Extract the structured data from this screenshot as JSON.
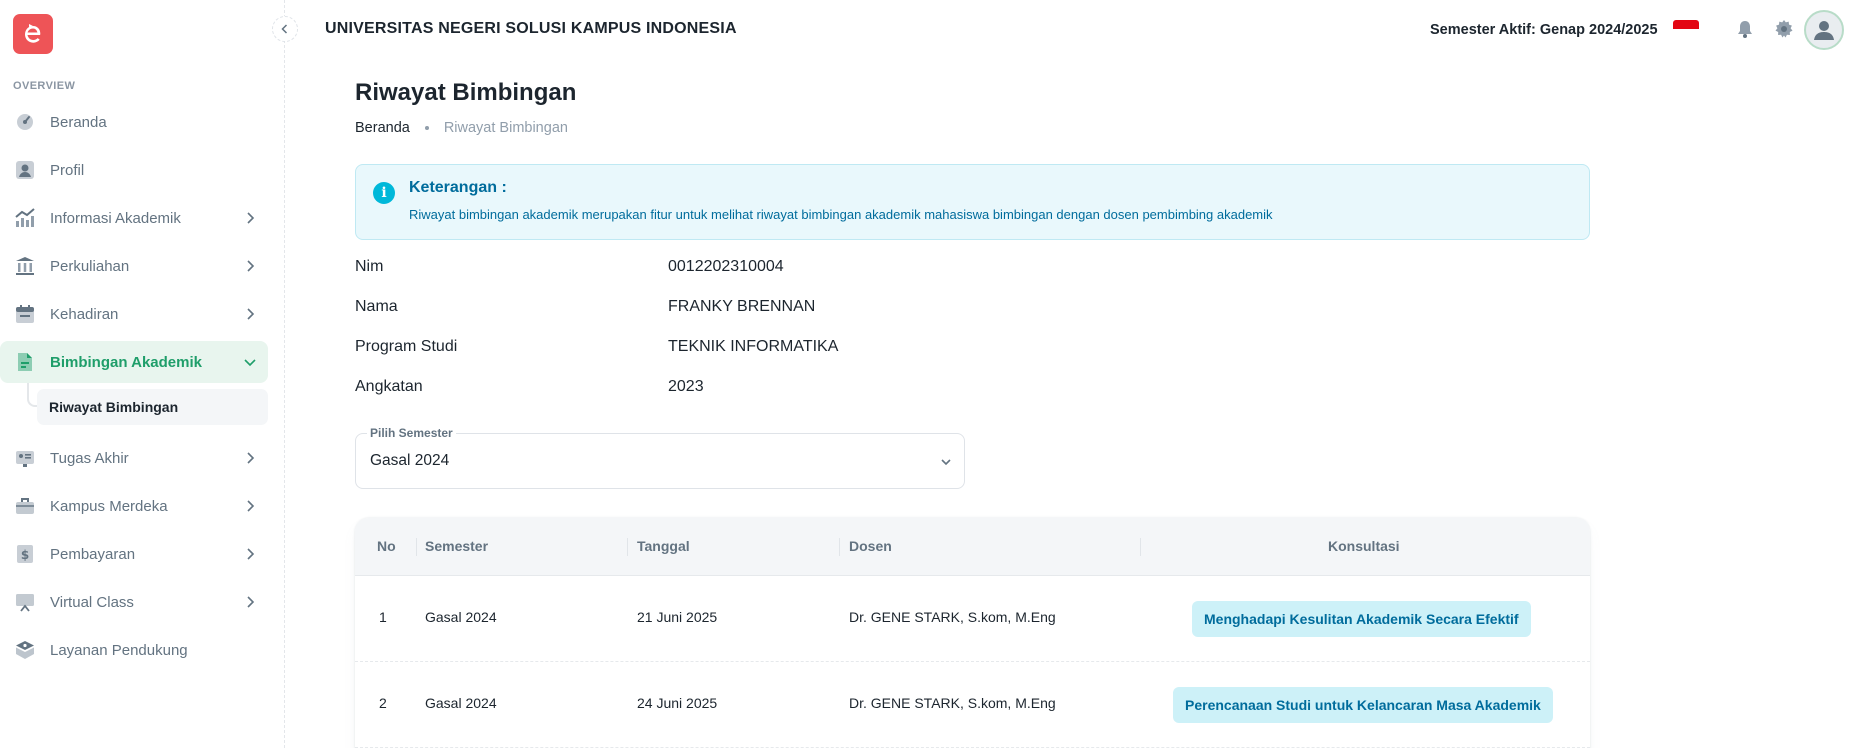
{
  "header": {
    "university": "UNIVERSITAS NEGERI SOLUSI KAMPUS INDONESIA",
    "semester_aktif": "Semester Aktif: Genap 2024/2025"
  },
  "sidebar": {
    "section": "OVERVIEW",
    "items": [
      {
        "label": "Beranda"
      },
      {
        "label": "Profil"
      },
      {
        "label": "Informasi Akademik"
      },
      {
        "label": "Perkuliahan"
      },
      {
        "label": "Kehadiran"
      },
      {
        "label": "Bimbingan Akademik"
      },
      {
        "label": "Tugas Akhir"
      },
      {
        "label": "Kampus Merdeka"
      },
      {
        "label": "Pembayaran"
      },
      {
        "label": "Virtual Class"
      },
      {
        "label": "Layanan Pendukung"
      }
    ],
    "sub_item": "Riwayat Bimbingan"
  },
  "page": {
    "title": "Riwayat Bimbingan",
    "breadcrumb": [
      "Beranda",
      "Riwayat Bimbingan"
    ]
  },
  "alert": {
    "title": "Keterangan :",
    "text": "Riwayat bimbingan akademik merupakan fitur untuk melihat riwayat bimbingan akademik mahasiswa bimbingan dengan dosen pembimbing akademik"
  },
  "student": [
    {
      "label": "Nim",
      "value": "0012202310004"
    },
    {
      "label": "Nama",
      "value": "FRANKY BRENNAN"
    },
    {
      "label": "Program Studi",
      "value": "TEKNIK INFORMATIKA"
    },
    {
      "label": "Angkatan",
      "value": "2023"
    }
  ],
  "select": {
    "label": "Pilih Semester",
    "value": "Gasal 2024"
  },
  "table": {
    "headers": [
      "No",
      "Semester",
      "Tanggal",
      "Dosen",
      "Konsultasi"
    ],
    "rows": [
      {
        "no": "1",
        "semester": "Gasal 2024",
        "tanggal": "21 Juni 2025",
        "dosen": "Dr. GENE STARK, S.kom, M.Eng",
        "konsultasi": "Menghadapi Kesulitan Akademik Secara Efektif"
      },
      {
        "no": "2",
        "semester": "Gasal 2024",
        "tanggal": "24 Juni 2025",
        "dosen": "Dr. GENE STARK, S.kom, M.Eng",
        "konsultasi": "Perencanaan Studi untuk Kelancaran Masa Akademik"
      }
    ]
  },
  "colors": {
    "accent": "#1f9e6a",
    "info": "#006c9c",
    "logo": "#ee5457"
  }
}
